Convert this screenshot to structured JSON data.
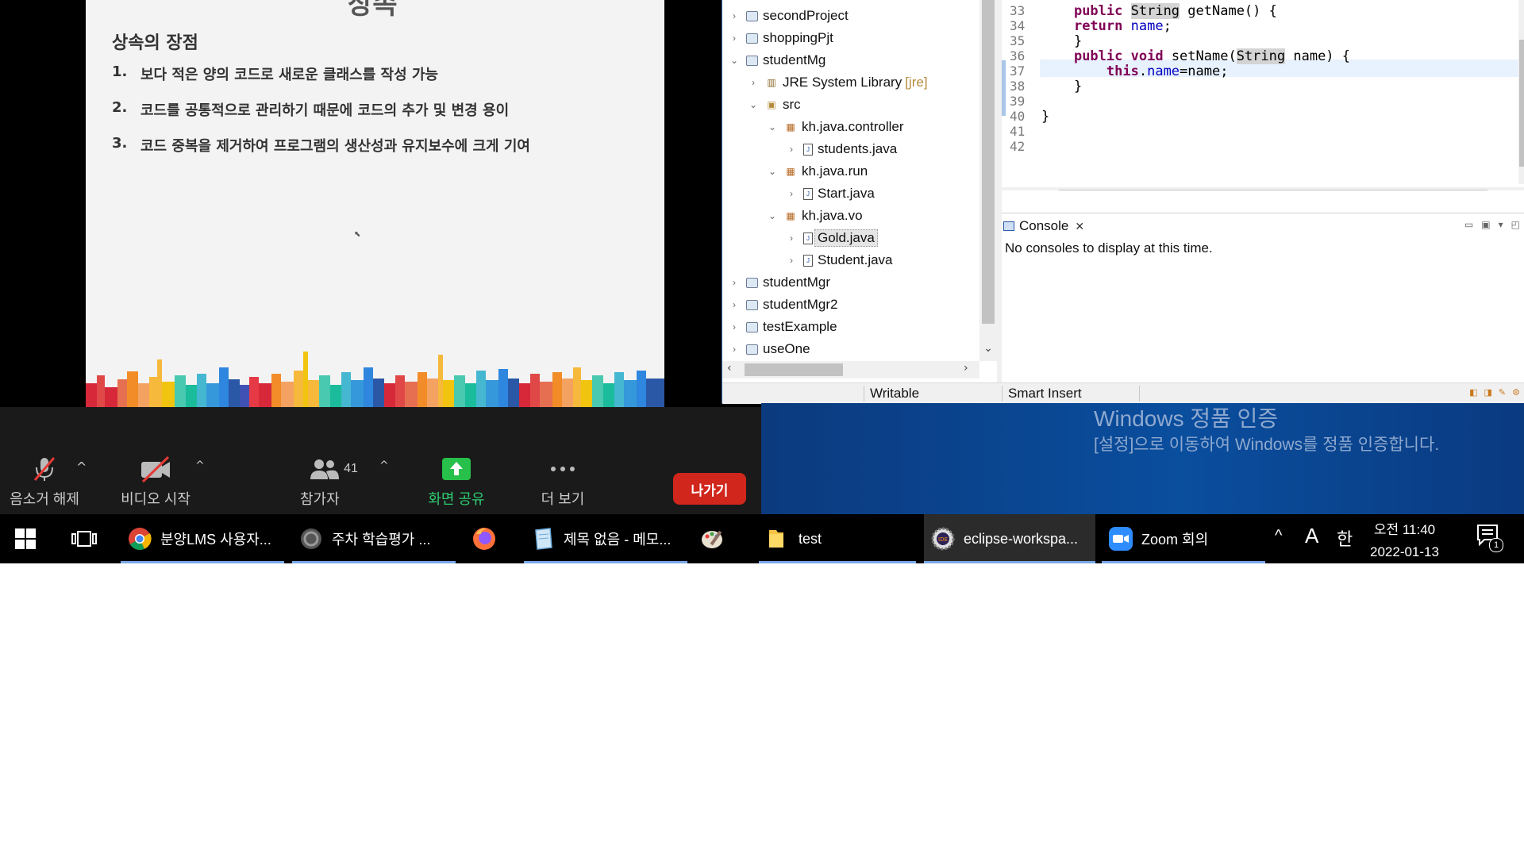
{
  "slide": {
    "heading_top": "상속",
    "title": "상속의 장점",
    "items": [
      {
        "num": "1.",
        "text": "보다 적은 양의 코드로 새로운 클래스를 작성 가능"
      },
      {
        "num": "2.",
        "text": "코드를 공통적으로 관리하기 때문에 코드의 추가 및 변경 용이"
      },
      {
        "num": "3.",
        "text": "코드 중복을 제거하여 프로그램의 생산성과 유지보수에 크게 기여"
      }
    ]
  },
  "package_explorer": {
    "rows": [
      {
        "label": "secondProject",
        "icon": "project-icon",
        "chevron": "›"
      },
      {
        "label": "shoppingPjt",
        "icon": "project-icon",
        "chevron": "›"
      },
      {
        "label": "studentMg",
        "icon": "project-icon",
        "chevron": "⌄"
      },
      {
        "label": "JRE System Library",
        "decor": "[jre]",
        "icon": "library-icon",
        "chevron": "›"
      },
      {
        "label": "src",
        "icon": "source-folder-icon",
        "chevron": "⌄"
      },
      {
        "label": "kh.java.controller",
        "icon": "package-icon",
        "chevron": "⌄"
      },
      {
        "label": "students.java",
        "icon": "java-file-icon",
        "chevron": "›"
      },
      {
        "label": "kh.java.run",
        "icon": "package-icon",
        "chevron": "⌄"
      },
      {
        "label": "Start.java",
        "icon": "java-file-icon",
        "chevron": "›"
      },
      {
        "label": "kh.java.vo",
        "icon": "package-icon",
        "chevron": "⌄"
      },
      {
        "label": "Gold.java",
        "icon": "java-file-icon",
        "chevron": "›",
        "selected": true
      },
      {
        "label": "Student.java",
        "icon": "java-file-icon",
        "chevron": "›"
      },
      {
        "label": "studentMgr",
        "icon": "project-icon",
        "chevron": "›"
      },
      {
        "label": "studentMgr2",
        "icon": "project-icon",
        "chevron": "›"
      },
      {
        "label": "testExample",
        "icon": "project-icon",
        "chevron": "›"
      },
      {
        "label": "useOne",
        "icon": "project-icon",
        "chevron": "›"
      }
    ]
  },
  "editor": {
    "line_numbers": [
      "33",
      "34",
      "35",
      "36",
      "37",
      "38",
      "39",
      "40",
      "41",
      "42"
    ],
    "lines": [
      [
        "    ",
        {
          "t": "public",
          "c": "kw"
        },
        " ",
        {
          "t": "String",
          "c": "hl"
        },
        " getName() {"
      ],
      [
        "    ",
        {
          "t": "return",
          "c": "kw"
        },
        " ",
        {
          "t": "name",
          "c": "fld"
        },
        ";"
      ],
      [
        "    }"
      ],
      [
        "    ",
        {
          "t": "public",
          "c": "kw"
        },
        " ",
        {
          "t": "void",
          "c": "kw"
        },
        " setName(",
        {
          "t": "String",
          "c": "hl"
        },
        " name) {"
      ],
      [
        "        ",
        {
          "t": "this",
          "c": "kw"
        },
        ".",
        {
          "t": "name",
          "c": "fld"
        },
        "=name;"
      ],
      [
        "    }"
      ],
      [
        ""
      ],
      [
        "}"
      ],
      [
        ""
      ],
      [
        ""
      ]
    ]
  },
  "console": {
    "tab_label": "Console",
    "close_glyph": "✕",
    "message": "No consoles to display at this time."
  },
  "statusbar": {
    "writable": "Writable",
    "insert_mode": "Smart Insert"
  },
  "windows_activation": {
    "title": "Windows 정품 인증",
    "subtitle": "[설정]으로 이동하여 Windows를 정품 인증합니다."
  },
  "zoom": {
    "mute_label": "음소거 해제",
    "video_label": "비디오 시작",
    "participants_label": "참가자",
    "participants_count": "41",
    "share_label": "화면 공유",
    "more_label": "더 보기",
    "leave_label": "나가기",
    "share_color": "#2ecc71",
    "leave_color": "#d0261c"
  },
  "taskbar": {
    "items": [
      {
        "label": "분양LMS 사용자...",
        "icon": "chrome-icon"
      },
      {
        "label": "주차 학습평가 ...",
        "icon": "browser-icon"
      },
      {
        "label": "",
        "icon": "firefox-icon"
      },
      {
        "label": "제목 없음 - 메모...",
        "icon": "notepad-icon"
      },
      {
        "label": "",
        "icon": "paint-icon"
      },
      {
        "label": "test",
        "icon": "folder-icon"
      },
      {
        "label": "eclipse-workspa...",
        "icon": "eclipse-icon"
      },
      {
        "label": "Zoom 회의",
        "icon": "zoom-icon"
      }
    ],
    "tray_ime_letter": "A",
    "tray_lang": "한",
    "time": "오전 11:40",
    "date": "2022-01-13",
    "notification_count": "1"
  }
}
